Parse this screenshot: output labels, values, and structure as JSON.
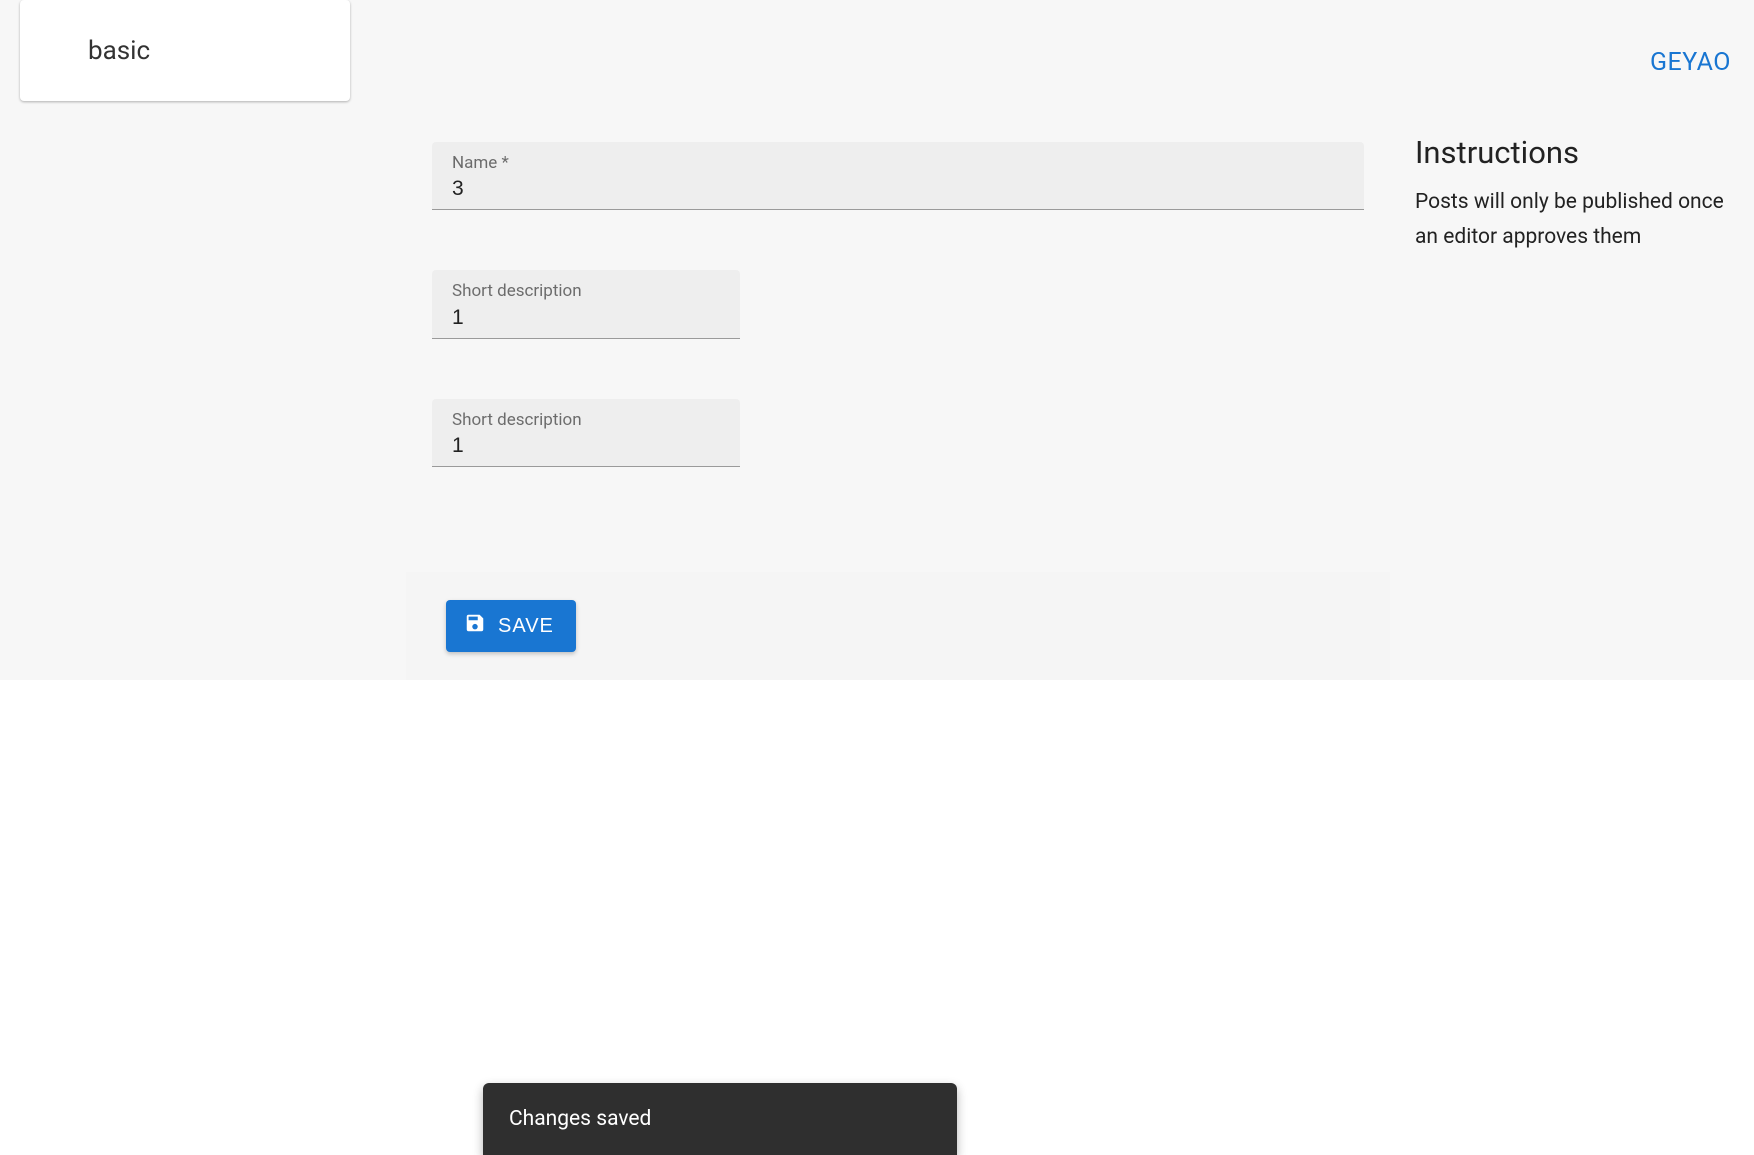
{
  "card": {
    "label": "basic"
  },
  "user": {
    "name": "GEYAO"
  },
  "form": {
    "name_label": "Name *",
    "name_value": "3",
    "short_desc_label_1": "Short description",
    "short_desc_value_1": "1",
    "short_desc_label_2": "Short description",
    "short_desc_value_2": "1"
  },
  "toolbar": {
    "save_label": "SAVE"
  },
  "instructions": {
    "title": "Instructions",
    "body": "Posts will only be published once an editor approves them"
  },
  "snackbar": {
    "message": "Changes saved"
  }
}
